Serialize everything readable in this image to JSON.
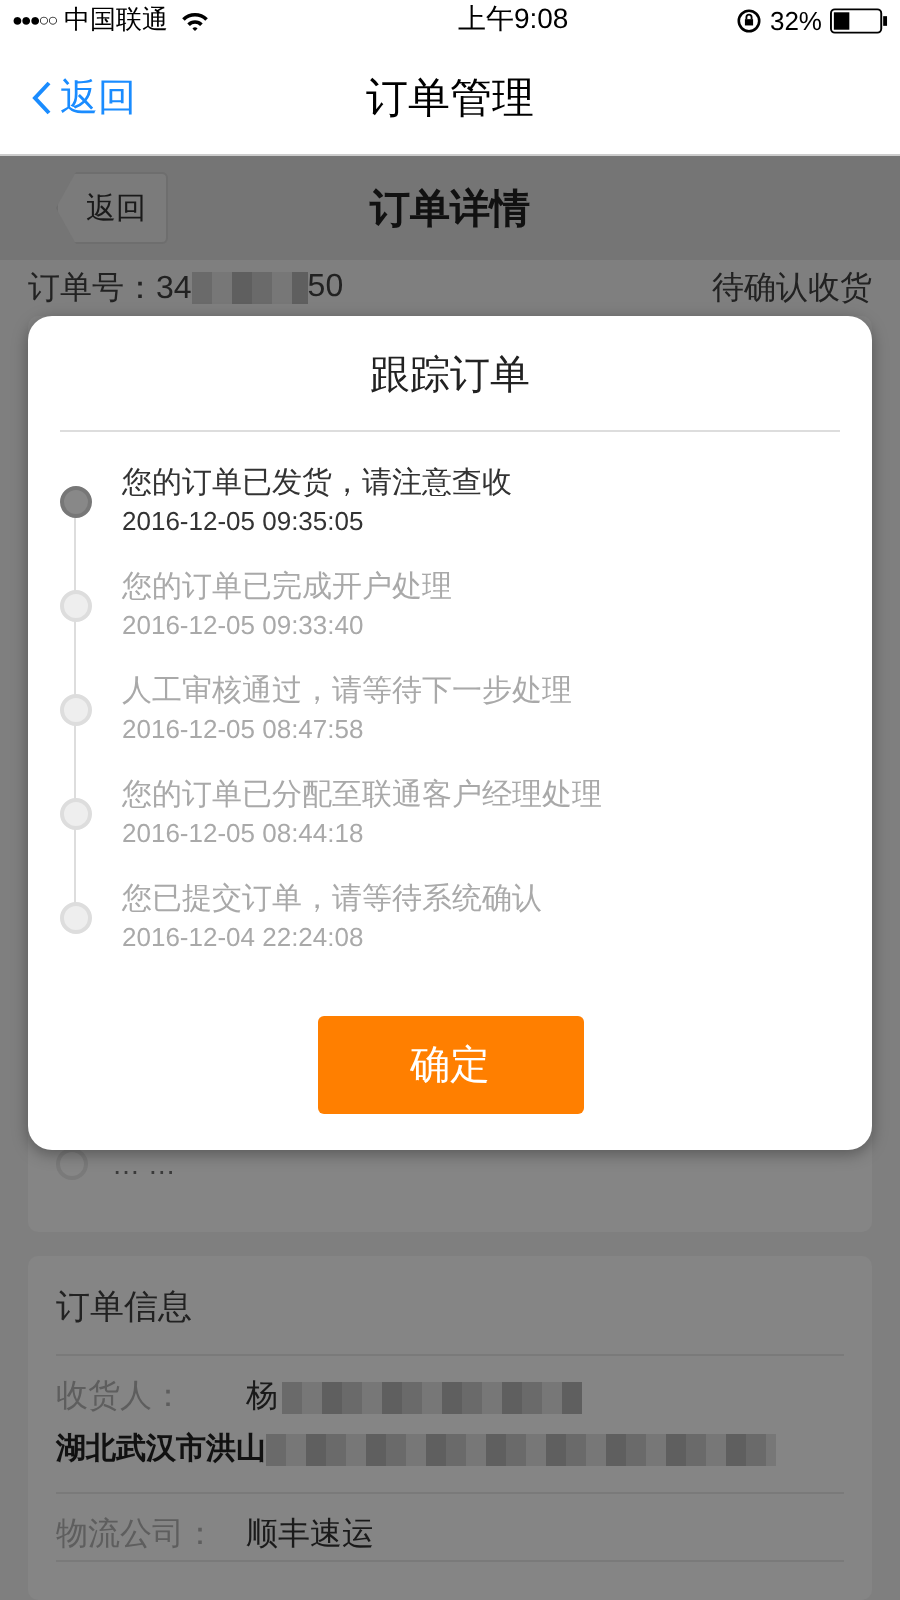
{
  "status_bar": {
    "signal": "●●●○○",
    "carrier": "中国联通",
    "time": "上午9:08",
    "battery": "32%"
  },
  "nav": {
    "back": "返回",
    "title": "订单管理"
  },
  "page": {
    "back": "返回",
    "title": "订单详情",
    "order_number_start": "订单号：34",
    "order_number_end": "50",
    "status": "待确认收货",
    "track_more": "… …",
    "info": {
      "title": "订单信息",
      "recipient_label": "收货人：",
      "recipient_name": "杨",
      "address": "湖北武汉市洪山",
      "logistics_label": "物流公司：",
      "logistics_value": "顺丰速运"
    }
  },
  "dialog": {
    "title": "跟踪订单",
    "events": [
      {
        "text": "您的订单已发货，请注意查收",
        "time": "2016-12-05 09:35:05",
        "current": true
      },
      {
        "text": "您的订单已完成开户处理",
        "time": "2016-12-05 09:33:40",
        "current": false
      },
      {
        "text": "人工审核通过，请等待下一步处理",
        "time": "2016-12-05 08:47:58",
        "current": false
      },
      {
        "text": "您的订单已分配至联通客户经理处理",
        "time": "2016-12-05 08:44:18",
        "current": false
      },
      {
        "text": "您已提交订单，请等待系统确认",
        "time": "2016-12-04 22:24:08",
        "current": false
      }
    ],
    "button": "确定"
  }
}
